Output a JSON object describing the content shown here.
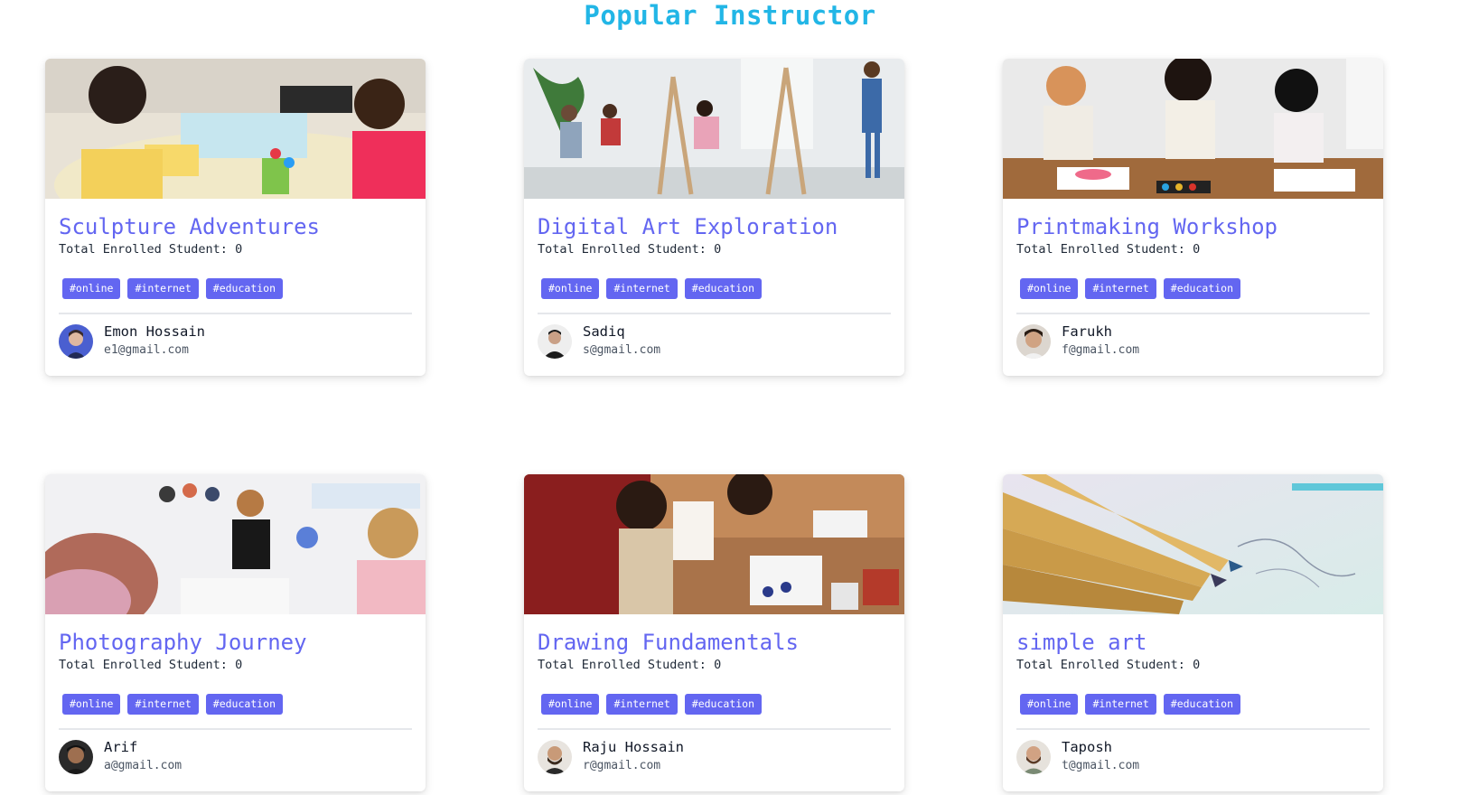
{
  "page": {
    "section_title": "Popular Instructor"
  },
  "cards": [
    {
      "class_name": "Sculpture Adventures",
      "enrolled_label": "Total Enrolled Student: 0",
      "tags": [
        "#online",
        "#internet",
        "#education"
      ],
      "instructor_name": "Emon Hossain",
      "instructor_email": "e1@gmail.com",
      "image_theme": "kids-crafts"
    },
    {
      "class_name": "Digital Art Exploration",
      "enrolled_label": "Total Enrolled Student: 0",
      "tags": [
        "#online",
        "#internet",
        "#education"
      ],
      "instructor_name": "Sadiq",
      "instructor_email": "s@gmail.com",
      "image_theme": "art-studio-easels"
    },
    {
      "class_name": "Printmaking Workshop",
      "enrolled_label": "Total Enrolled Student: 0",
      "tags": [
        "#online",
        "#internet",
        "#education"
      ],
      "instructor_name": "Farukh",
      "instructor_email": "f@gmail.com",
      "image_theme": "kids-painting"
    },
    {
      "class_name": "Photography Journey",
      "enrolled_label": "Total Enrolled Student: 0",
      "tags": [
        "#online",
        "#internet",
        "#education"
      ],
      "instructor_name": "Arif",
      "instructor_email": "a@gmail.com",
      "image_theme": "kids-classroom"
    },
    {
      "class_name": "Drawing Fundamentals",
      "enrolled_label": "Total Enrolled Student: 0",
      "tags": [
        "#online",
        "#internet",
        "#education"
      ],
      "instructor_name": "Raju Hossain",
      "instructor_email": "r@gmail.com",
      "image_theme": "kids-drawing-table"
    },
    {
      "class_name": "simple art",
      "enrolled_label": "Total Enrolled Student: 0",
      "tags": [
        "#online",
        "#internet",
        "#education"
      ],
      "instructor_name": "Taposh",
      "instructor_email": "t@gmail.com",
      "image_theme": "colored-pencils"
    }
  ],
  "colors": {
    "title": "#22b6e6",
    "accent": "#6366f1",
    "tag_text": "#ffffff"
  }
}
